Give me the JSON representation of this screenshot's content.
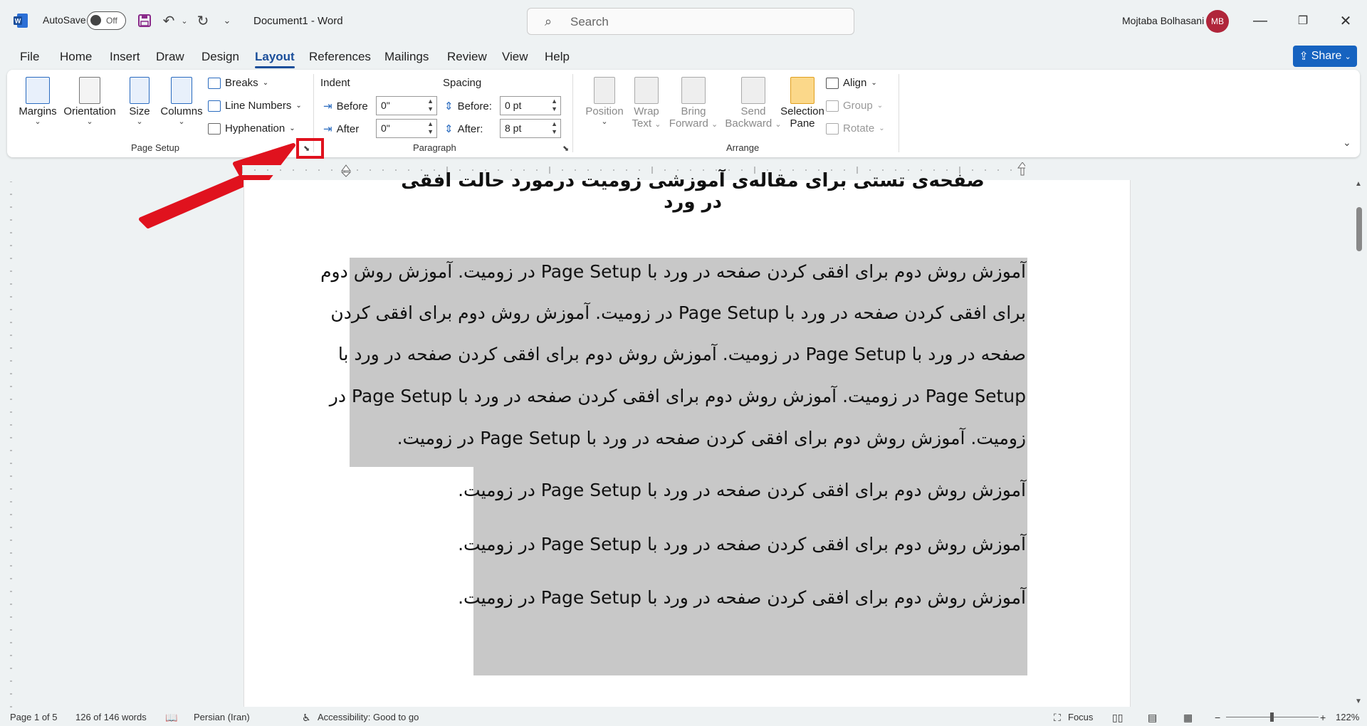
{
  "titlebar": {
    "autosave_label": "AutoSave",
    "autosave_state": "Off",
    "doc_title": "Document1  -  Word",
    "search_placeholder": "Search",
    "user_name": "Mojtaba Bolhasani",
    "user_initials": "MB"
  },
  "menu": {
    "tabs": [
      "File",
      "Home",
      "Insert",
      "Draw",
      "Design",
      "Layout",
      "References",
      "Mailings",
      "Review",
      "View",
      "Help"
    ],
    "active": "Layout",
    "share_label": "Share"
  },
  "ribbon": {
    "page_setup": {
      "margins": "Margins",
      "orientation": "Orientation",
      "size": "Size",
      "columns": "Columns",
      "breaks": "Breaks",
      "line_numbers": "Line Numbers",
      "hyphenation": "Hyphenation",
      "label": "Page Setup"
    },
    "paragraph": {
      "indent_label": "Indent",
      "spacing_label": "Spacing",
      "before_label": "Before",
      "after_label": "After",
      "indent_before": "0\"",
      "indent_after": "0\"",
      "spacing_before_label": "Before:",
      "spacing_after_label": "After:",
      "spacing_before": "0 pt",
      "spacing_after": "8 pt",
      "label": "Paragraph"
    },
    "arrange": {
      "position": "Position",
      "wrap_1": "Wrap",
      "wrap_2": "Text",
      "bring_1": "Bring",
      "bring_2": "Forward",
      "send_1": "Send",
      "send_2": "Backward",
      "sel_1": "Selection",
      "sel_2": "Pane",
      "align": "Align",
      "group": "Group",
      "rotate": "Rotate",
      "label": "Arrange"
    }
  },
  "document": {
    "heading": "صفحه‌ی تستی برای مقاله‌ی آموزشی زومیت درمورد حالت افقی در ورد",
    "lines": [
      "آموزش روش دوم برای افقی کردن صفحه در ورد با Page Setup در زومیت. آموزش روش دوم",
      "برای افقی کردن صفحه در ورد با Page Setup در زومیت. آموزش روش دوم برای افقی کردن",
      "صفحه در ورد با Page Setup در زومیت. آموزش روش دوم برای افقی کردن صفحه در ورد با",
      "Page Setup در زومیت. آموزش روش دوم برای افقی کردن صفحه در ورد با Page Setup در",
      "زومیت. آموزش روش دوم برای افقی کردن صفحه در ورد با Page Setup در زومیت.",
      "آموزش روش دوم برای افقی کردن صفحه در ورد با Page Setup در زومیت.",
      "آموزش روش دوم برای افقی کردن صفحه در ورد با Page Setup در زومیت.",
      "آموزش روش دوم برای افقی کردن صفحه در ورد با Page Setup در زومیت."
    ]
  },
  "statusbar": {
    "page": "Page 1 of 5",
    "words": "126 of 146 words",
    "language": "Persian (Iran)",
    "accessibility": "Accessibility: Good to go",
    "focus": "Focus",
    "zoom": "122%"
  },
  "colors": {
    "accent": "#1a4e9a",
    "share": "#1663c0",
    "highlight": "#e0121e",
    "selection": "#c8c8c8"
  }
}
